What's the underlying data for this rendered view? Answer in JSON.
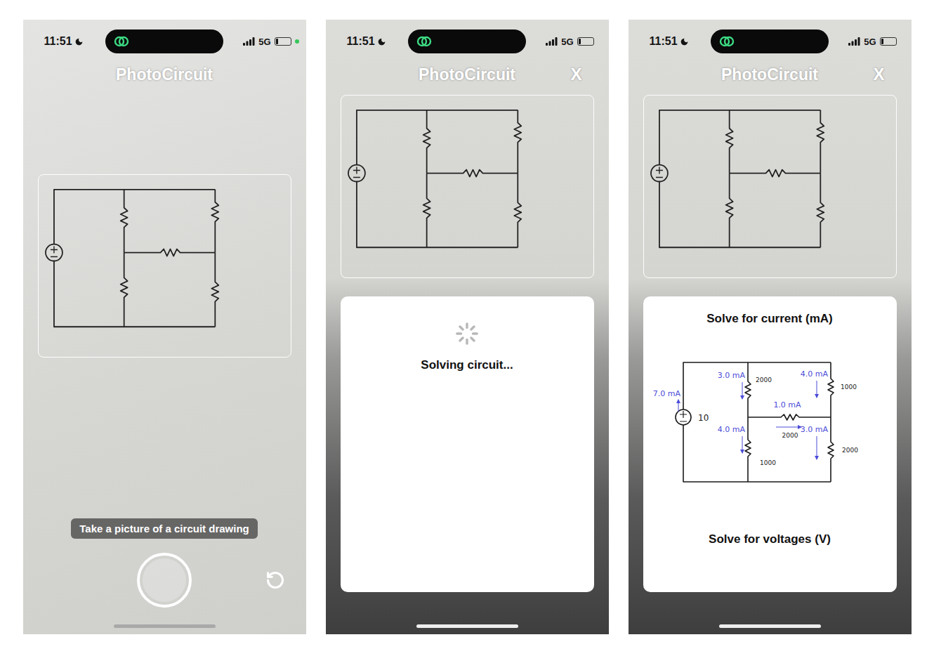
{
  "status_bar": {
    "time": "11:51",
    "network": "5G",
    "battery_level": 0.18
  },
  "screens": [
    {
      "kind": "camera",
      "title": "PhotoCircuit",
      "camera_in_use": true,
      "hint": "Take a picture of a circuit drawing"
    },
    {
      "kind": "solving",
      "title": "PhotoCircuit",
      "camera_in_use": false,
      "close": "X",
      "status": "Solving circuit..."
    },
    {
      "kind": "result",
      "title": "PhotoCircuit",
      "camera_in_use": false,
      "close": "X",
      "sections": [
        "Solve for current (mA)",
        "Solve for voltages (V)"
      ],
      "circuit": {
        "source": "10",
        "resistors": [
          {
            "branch": "top-left",
            "value": "2000"
          },
          {
            "branch": "top-right",
            "value": "1000"
          },
          {
            "branch": "middle",
            "value": "2000"
          },
          {
            "branch": "bottom-left",
            "value": "1000"
          },
          {
            "branch": "bottom-right",
            "value": "2000"
          }
        ],
        "currents": [
          {
            "branch": "source",
            "label": "7.0 mA"
          },
          {
            "branch": "top-left",
            "label": "3.0 mA"
          },
          {
            "branch": "top-right",
            "label": "4.0 mA"
          },
          {
            "branch": "middle",
            "label": "1.0 mA"
          },
          {
            "branch": "bottom-left",
            "label": "4.0 mA"
          },
          {
            "branch": "bottom-right",
            "label": "3.0 mA"
          }
        ]
      }
    }
  ]
}
